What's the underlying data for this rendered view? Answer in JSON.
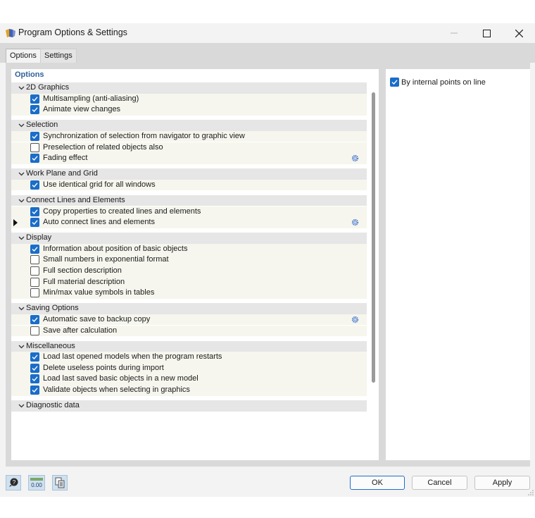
{
  "window": {
    "title": "Program Options & Settings"
  },
  "tabs": [
    {
      "label": "Options",
      "active": true
    },
    {
      "label": "Settings",
      "active": false
    }
  ],
  "options_panel": {
    "header": "Options",
    "groups": [
      {
        "label": "2D Graphics",
        "items": [
          {
            "label": "Multisampling (anti-aliasing)",
            "checked": true
          },
          {
            "label": "Animate view changes",
            "checked": true
          }
        ]
      },
      {
        "label": "Selection",
        "items": [
          {
            "label": "Synchronization of selection from navigator to graphic view",
            "checked": true
          },
          {
            "label": "Preselection of related objects also",
            "checked": false
          },
          {
            "label": "Fading effect",
            "checked": true,
            "settings_icon": true
          }
        ]
      },
      {
        "label": "Work Plane and Grid",
        "items": [
          {
            "label": "Use identical grid for all windows",
            "checked": true
          }
        ]
      },
      {
        "label": "Connect Lines and Elements",
        "items": [
          {
            "label": "Copy properties to created lines and elements",
            "checked": true
          },
          {
            "label": "Auto connect lines and elements",
            "checked": true,
            "settings_icon": true,
            "current": true
          }
        ]
      },
      {
        "label": "Display",
        "items": [
          {
            "label": "Information about position of basic objects",
            "checked": true
          },
          {
            "label": "Small numbers in exponential format",
            "checked": false
          },
          {
            "label": "Full section description",
            "checked": false
          },
          {
            "label": "Full material description",
            "checked": false
          },
          {
            "label": "Min/max value symbols in tables",
            "checked": false
          }
        ]
      },
      {
        "label": "Saving Options",
        "items": [
          {
            "label": "Automatic save to backup copy",
            "checked": true,
            "settings_icon": true
          },
          {
            "label": "Save after calculation",
            "checked": false
          }
        ]
      },
      {
        "label": "Miscellaneous",
        "items": [
          {
            "label": "Load last opened models when the program restarts",
            "checked": true
          },
          {
            "label": "Delete useless points during import",
            "checked": true
          },
          {
            "label": "Load last saved basic objects in a new model",
            "checked": true
          },
          {
            "label": "Validate objects when selecting in graphics",
            "checked": true
          }
        ]
      },
      {
        "label": "Diagnostic data",
        "items": []
      }
    ]
  },
  "detail_panel": {
    "option": {
      "label": "By internal points on line",
      "checked": true
    }
  },
  "footer": {
    "tool_icons": [
      "help-icon",
      "units-icon",
      "copy-icon"
    ],
    "units_icon_text": "0.00",
    "ok_label": "OK",
    "cancel_label": "Cancel",
    "apply_label": "Apply"
  },
  "colors": {
    "accent": "#1a6dc9",
    "header_text": "#2f6299",
    "group_bg": "#e6e6e6",
    "item_bg": "#f6f6ee"
  }
}
